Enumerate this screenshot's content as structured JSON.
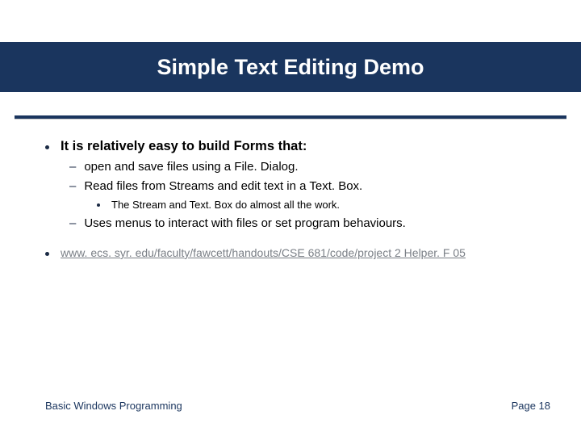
{
  "title": "Simple Text Editing Demo",
  "bullets": {
    "main": "It is relatively easy to build Forms that:",
    "subs": [
      "open and save files using a File. Dialog.",
      "Read files from Streams and edit text in a Text. Box."
    ],
    "subsub": "The Stream and Text. Box do almost all the work.",
    "sub_after": "Uses menus to interact with files or set program behaviours."
  },
  "link": "www. ecs. syr. edu/faculty/fawcett/handouts/CSE 681/code/project 2 Helper. F 05",
  "footer": {
    "left": "Basic Windows Programming",
    "right": "Page 18"
  }
}
